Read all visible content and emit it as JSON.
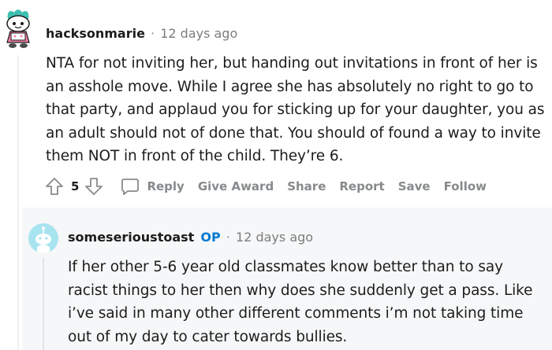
{
  "comment": {
    "username": "hacksonmarie",
    "separator": "·",
    "time": "12 days ago",
    "body": "NTA for not inviting her, but handing out invitations in front of her is an asshole move. While I agree she has absolutely no right to go to that party, and applaud you for sticking up for your daughter, you as an adult should not of done that. You should of found a way to invite them NOT in front of the child. They’re 6.",
    "votes": "5",
    "actions": {
      "reply": "Reply",
      "give_award": "Give Award",
      "share": "Share",
      "report": "Report",
      "save": "Save",
      "follow": "Follow"
    }
  },
  "reply": {
    "username": "someserioustoast",
    "op_badge": "OP",
    "separator": "·",
    "time": "12 days ago",
    "body": "If her other 5-6 year old classmates know better than to say racist things to her then why does she suddenly get a pass. Like i’ve said in many other different comments i’m not taking time out of my day to cater towards bullies."
  },
  "icons": {
    "avatar_main": "snoo-avatar-teal-hair",
    "avatar_reply": "default-snoo-avatar",
    "upvote": "upvote-arrow-icon",
    "downvote": "downvote-arrow-icon",
    "reply": "speech-bubble-icon"
  },
  "colors": {
    "op_badge": "#0079d3",
    "muted_text": "#878a8c",
    "reply_background": "#f6f7f8",
    "avatar_reply_bg": "#a8e4ef"
  }
}
